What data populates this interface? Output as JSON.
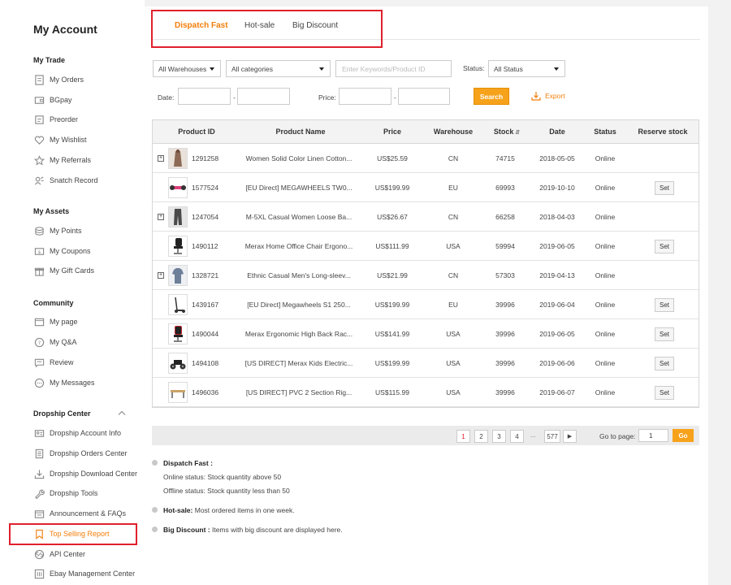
{
  "sidebar": {
    "title": "My Account",
    "sections": [
      {
        "title": "My Trade",
        "items": [
          {
            "label": "My Orders",
            "icon": "orders-icon"
          },
          {
            "label": "BGpay",
            "icon": "wallet-icon"
          },
          {
            "label": "Preorder",
            "icon": "preorder-icon"
          },
          {
            "label": "My Wishlist",
            "icon": "heart-icon"
          },
          {
            "label": "My Referrals",
            "icon": "star-icon"
          },
          {
            "label": "Snatch Record",
            "icon": "snatch-icon"
          }
        ]
      },
      {
        "title": "My Assets",
        "items": [
          {
            "label": "My Points",
            "icon": "coins-icon"
          },
          {
            "label": "My Coupons",
            "icon": "coupon-icon"
          },
          {
            "label": "My Gift Cards",
            "icon": "gift-icon"
          }
        ]
      },
      {
        "title": "Community",
        "items": [
          {
            "label": "My page",
            "icon": "page-icon"
          },
          {
            "label": "My Q&A",
            "icon": "question-icon"
          },
          {
            "label": "Review",
            "icon": "review-icon"
          },
          {
            "label": "My Messages",
            "icon": "message-icon"
          }
        ]
      },
      {
        "title": "Dropship Center",
        "items": [
          {
            "label": "Dropship Account Info",
            "icon": "id-card-icon"
          },
          {
            "label": "Dropship Orders Center",
            "icon": "document-icon"
          },
          {
            "label": "Dropship Download Center",
            "icon": "download-icon"
          },
          {
            "label": "Dropship Tools",
            "icon": "wrench-icon"
          },
          {
            "label": "Announcement & FAQs",
            "icon": "announcement-icon"
          },
          {
            "label": "Top Selling Report",
            "icon": "bookmark-icon",
            "active": true
          },
          {
            "label": "API Center",
            "icon": "api-icon"
          },
          {
            "label": "Ebay Management Center",
            "icon": "ebay-icon"
          }
        ]
      }
    ]
  },
  "tabs": [
    {
      "label": "Dispatch Fast",
      "active": true
    },
    {
      "label": "Hot-sale"
    },
    {
      "label": "Big Discount"
    }
  ],
  "filters": {
    "warehouse": "All Warehouses",
    "category": "All categories",
    "keyword_placeholder": "Enter Keywords/Product ID",
    "status_label": "Status:",
    "status": "All Status",
    "date_label": "Date:",
    "price_label": "Price:",
    "dash": "-",
    "search_label": "Search",
    "export_label": "Export"
  },
  "table": {
    "headers": [
      "Product ID",
      "Product Name",
      "Price",
      "Warehouse",
      "Stock",
      "Date",
      "Status",
      "Reserve stock"
    ],
    "rows": [
      {
        "id": "1291258",
        "name": "Women Solid Color Linen Cotton...",
        "price": "US$25.59",
        "warehouse": "CN",
        "stock": "74715",
        "date": "2018-05-05",
        "status": "Online",
        "expandable": true,
        "set": "",
        "thumb": "dress"
      },
      {
        "id": "1577524",
        "name": "[EU Direct] MEGAWHEELS TW0...",
        "price": "US$199.99",
        "warehouse": "EU",
        "stock": "69993",
        "date": "2019-10-10",
        "status": "Online",
        "expandable": false,
        "set": "Set",
        "thumb": "hoverboard"
      },
      {
        "id": "1247054",
        "name": "M-5XL Casual Women Loose Ba...",
        "price": "US$26.67",
        "warehouse": "CN",
        "stock": "66258",
        "date": "2018-04-03",
        "status": "Online",
        "expandable": true,
        "set": "",
        "thumb": "pants"
      },
      {
        "id": "1490112",
        "name": "Merax Home Office Chair Ergono...",
        "price": "US$111.99",
        "warehouse": "USA",
        "stock": "59994",
        "date": "2019-06-05",
        "status": "Online",
        "expandable": false,
        "set": "Set",
        "thumb": "chair"
      },
      {
        "id": "1328721",
        "name": "Ethnic Casual Men's Long-sleev...",
        "price": "US$21.99",
        "warehouse": "CN",
        "stock": "57303",
        "date": "2019-04-13",
        "status": "Online",
        "expandable": true,
        "set": "",
        "thumb": "shirt"
      },
      {
        "id": "1439167",
        "name": "[EU Direct] Megawheels S1 250...",
        "price": "US$199.99",
        "warehouse": "EU",
        "stock": "39996",
        "date": "2019-06-04",
        "status": "Online",
        "expandable": false,
        "set": "Set",
        "thumb": "scooter"
      },
      {
        "id": "1490044",
        "name": "Merax Ergonomic High Back Rac...",
        "price": "US$141.99",
        "warehouse": "USA",
        "stock": "39996",
        "date": "2019-06-05",
        "status": "Online",
        "expandable": false,
        "set": "Set",
        "thumb": "gaming-chair"
      },
      {
        "id": "1494108",
        "name": "[US DIRECT] Merax Kids Electric...",
        "price": "US$199.99",
        "warehouse": "USA",
        "stock": "39996",
        "date": "2019-06-06",
        "status": "Online",
        "expandable": false,
        "set": "Set",
        "thumb": "atv"
      },
      {
        "id": "1496036",
        "name": "[US DIRECT] PVC 2 Section Rig...",
        "price": "US$115.99",
        "warehouse": "USA",
        "stock": "39996",
        "date": "2019-06-07",
        "status": "Online",
        "expandable": false,
        "set": "Set",
        "thumb": "table"
      }
    ]
  },
  "pagination": {
    "pages": [
      "1",
      "2",
      "3",
      "4"
    ],
    "current": "1",
    "dots": "...",
    "last": "577",
    "goto_label": "Go to page:",
    "goto_value": "1",
    "go_label": "Go"
  },
  "notes": {
    "dispatch_title": "Dispatch Fast :",
    "dispatch_online": "Online status: Stock quantity above 50",
    "dispatch_offline": "Offline status: Stock quantity less than 50",
    "hot_title": "Hot-sale:",
    "hot_text": "Most ordered items in one week.",
    "discount_title": "Big Discount :",
    "discount_text": "Items with big discount are displayed here."
  },
  "colors": {
    "accent": "#f47d0a",
    "highlight_border": "#e0202d",
    "button": "#f7a21b"
  }
}
